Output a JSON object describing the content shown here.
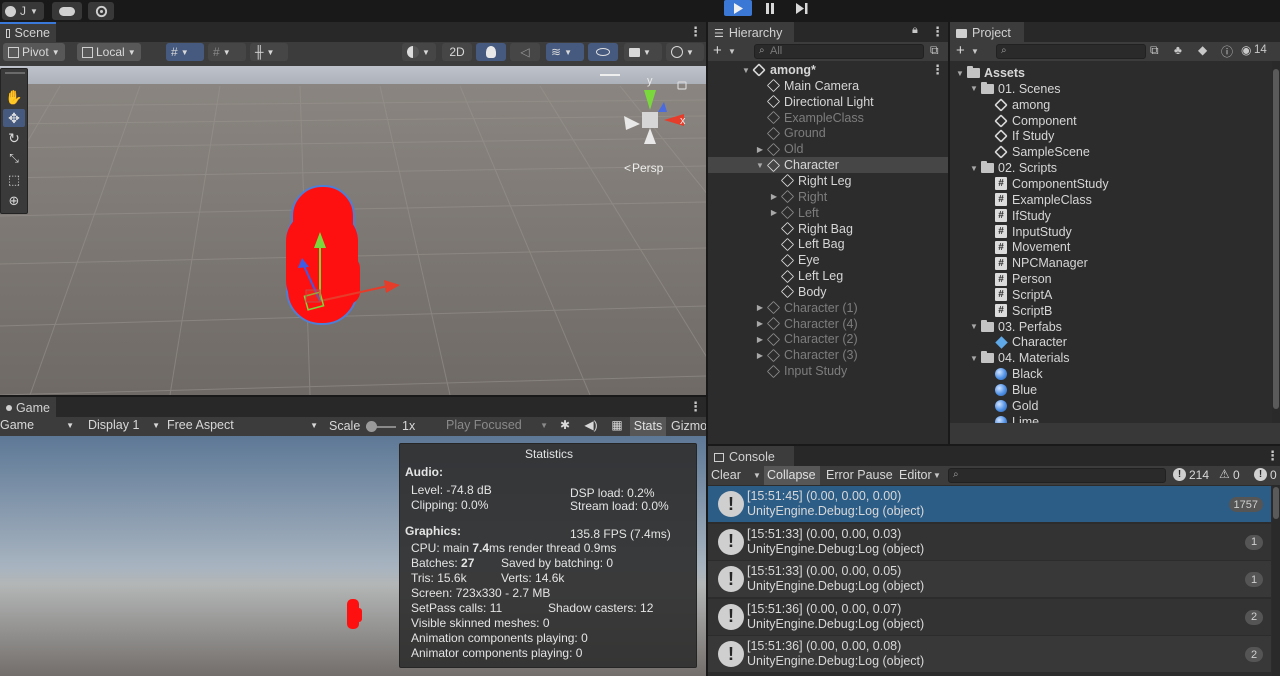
{
  "topbar": {
    "account_label": "J",
    "play_icon": "play-icon",
    "pause_icon": "pause-icon",
    "step_icon": "step-icon"
  },
  "scene": {
    "tab_label": "Scene",
    "pivot_label": "Pivot",
    "local_label": "Local",
    "mode_2d": "2D",
    "persp_label": "Persp",
    "gizmo_y": "y",
    "gizmo_x": "x"
  },
  "game": {
    "tab_label": "Game",
    "view_select": "Game",
    "display_select": "Display 1",
    "aspect_select": "Free Aspect",
    "scale_label": "Scale",
    "scale_value": "1x",
    "play_focused": "Play Focused",
    "stats_label": "Stats",
    "gizmos_label": "Gizmo"
  },
  "stats": {
    "title": "Statistics",
    "audio_heading": "Audio:",
    "level": "Level: -74.8 dB",
    "clipping": "Clipping: 0.0%",
    "dsp": "DSP load: 0.2%",
    "stream": "Stream load: 0.0%",
    "graphics_heading": "Graphics:",
    "fps": "135.8 FPS (7.4ms)",
    "cpu_prefix": "CPU: main ",
    "cpu_main": "7.4",
    "cpu_suffix": "ms  render thread 0.9ms",
    "batches_prefix": "Batches: ",
    "batches": "27",
    "saved_batching": "Saved by batching: 0",
    "tris": "Tris: 15.6k",
    "verts": "Verts: 14.6k",
    "screen": "Screen: 723x330 - 2.7 MB",
    "setpass": "SetPass calls: 11",
    "shadow": "Shadow casters: 12",
    "skinned": "Visible skinned meshes: 0",
    "anim": "Animation components playing: 0",
    "animator": "Animator components playing: 0"
  },
  "hierarchy": {
    "tab_label": "Hierarchy",
    "search_placeholder": "All",
    "rows": [
      {
        "label": "among*",
        "indent": 0,
        "arrow": "down",
        "icon": "unity",
        "dim": false,
        "bold": true
      },
      {
        "label": "Main Camera",
        "indent": 1,
        "arrow": "",
        "icon": "cube",
        "dim": false
      },
      {
        "label": "Directional Light",
        "indent": 1,
        "arrow": "",
        "icon": "cube",
        "dim": false
      },
      {
        "label": "ExampleClass",
        "indent": 1,
        "arrow": "",
        "icon": "cube",
        "dim": true
      },
      {
        "label": "Ground",
        "indent": 1,
        "arrow": "",
        "icon": "cube",
        "dim": true
      },
      {
        "label": "Old",
        "indent": 1,
        "arrow": "right",
        "icon": "cube",
        "dim": true
      },
      {
        "label": "Character",
        "indent": 1,
        "arrow": "down",
        "icon": "cube",
        "dim": false,
        "selected": true
      },
      {
        "label": "Right Leg",
        "indent": 2,
        "arrow": "",
        "icon": "cube",
        "dim": false
      },
      {
        "label": "Right",
        "indent": 2,
        "arrow": "right",
        "icon": "cube",
        "dim": true
      },
      {
        "label": "Left",
        "indent": 2,
        "arrow": "right",
        "icon": "cube",
        "dim": true
      },
      {
        "label": "Right Bag",
        "indent": 2,
        "arrow": "",
        "icon": "cube",
        "dim": false
      },
      {
        "label": "Left Bag",
        "indent": 2,
        "arrow": "",
        "icon": "cube",
        "dim": false
      },
      {
        "label": "Eye",
        "indent": 2,
        "arrow": "",
        "icon": "cube",
        "dim": false
      },
      {
        "label": "Left Leg",
        "indent": 2,
        "arrow": "",
        "icon": "cube",
        "dim": false
      },
      {
        "label": "Body",
        "indent": 2,
        "arrow": "",
        "icon": "cube",
        "dim": false
      },
      {
        "label": "Character (1)",
        "indent": 1,
        "arrow": "right",
        "icon": "cube",
        "dim": true
      },
      {
        "label": "Character (4)",
        "indent": 1,
        "arrow": "right",
        "icon": "cube",
        "dim": true
      },
      {
        "label": "Character (2)",
        "indent": 1,
        "arrow": "right",
        "icon": "cube",
        "dim": true
      },
      {
        "label": "Character (3)",
        "indent": 1,
        "arrow": "right",
        "icon": "cube",
        "dim": true
      },
      {
        "label": "Input Study",
        "indent": 1,
        "arrow": "",
        "icon": "cube",
        "dim": true
      }
    ]
  },
  "project": {
    "tab_label": "Project",
    "hidden_count": "14",
    "rows": [
      {
        "label": "Assets",
        "indent": 0,
        "arrow": "down",
        "icon": "folder",
        "bold": true
      },
      {
        "label": "01. Scenes",
        "indent": 1,
        "arrow": "down",
        "icon": "folder"
      },
      {
        "label": "among",
        "indent": 2,
        "arrow": "",
        "icon": "unity"
      },
      {
        "label": "Component",
        "indent": 2,
        "arrow": "",
        "icon": "unity"
      },
      {
        "label": "If Study",
        "indent": 2,
        "arrow": "",
        "icon": "unity"
      },
      {
        "label": "SampleScene",
        "indent": 2,
        "arrow": "",
        "icon": "unity"
      },
      {
        "label": "02. Scripts",
        "indent": 1,
        "arrow": "down",
        "icon": "folder"
      },
      {
        "label": "ComponentStudy",
        "indent": 2,
        "arrow": "",
        "icon": "hash"
      },
      {
        "label": "ExampleClass",
        "indent": 2,
        "arrow": "",
        "icon": "hash"
      },
      {
        "label": "IfStudy",
        "indent": 2,
        "arrow": "",
        "icon": "hash"
      },
      {
        "label": "InputStudy",
        "indent": 2,
        "arrow": "",
        "icon": "hash"
      },
      {
        "label": "Movement",
        "indent": 2,
        "arrow": "",
        "icon": "hash"
      },
      {
        "label": "NPCManager",
        "indent": 2,
        "arrow": "",
        "icon": "hash"
      },
      {
        "label": "Person",
        "indent": 2,
        "arrow": "",
        "icon": "hash"
      },
      {
        "label": "ScriptA",
        "indent": 2,
        "arrow": "",
        "icon": "hash"
      },
      {
        "label": "ScriptB",
        "indent": 2,
        "arrow": "",
        "icon": "hash"
      },
      {
        "label": "03. Perfabs",
        "indent": 1,
        "arrow": "down",
        "icon": "folder"
      },
      {
        "label": "Character",
        "indent": 2,
        "arrow": "",
        "icon": "prefab"
      },
      {
        "label": "04. Materials",
        "indent": 1,
        "arrow": "down",
        "icon": "folder"
      },
      {
        "label": "Black",
        "indent": 2,
        "arrow": "",
        "icon": "mat"
      },
      {
        "label": "Blue",
        "indent": 2,
        "arrow": "",
        "icon": "mat"
      },
      {
        "label": "Gold",
        "indent": 2,
        "arrow": "",
        "icon": "mat"
      },
      {
        "label": "Lime",
        "indent": 2,
        "arrow": "",
        "icon": "mat"
      }
    ]
  },
  "console": {
    "tab_label": "Console",
    "clear_label": "Clear",
    "collapse_label": "Collapse",
    "error_pause_label": "Error Pause",
    "editor_label": "Editor",
    "warn_count": "214",
    "warn2_count": "0",
    "err_count": "0",
    "rows": [
      {
        "l1": "[15:51:45] (0.00, 0.00, 0.00)",
        "l2": "UnityEngine.Debug:Log (object)",
        "count": "1757",
        "selected": true
      },
      {
        "l1": "[15:51:33] (0.00, 0.00, 0.03)",
        "l2": "UnityEngine.Debug:Log (object)",
        "count": "1",
        "selected": false
      },
      {
        "l1": "[15:51:33] (0.00, 0.00, 0.05)",
        "l2": "UnityEngine.Debug:Log (object)",
        "count": "1",
        "selected": false
      },
      {
        "l1": "[15:51:36] (0.00, 0.00, 0.07)",
        "l2": "UnityEngine.Debug:Log (object)",
        "count": "2",
        "selected": false
      },
      {
        "l1": "[15:51:36] (0.00, 0.00, 0.08)",
        "l2": "UnityEngine.Debug:Log (object)",
        "count": "2",
        "selected": false
      }
    ]
  }
}
